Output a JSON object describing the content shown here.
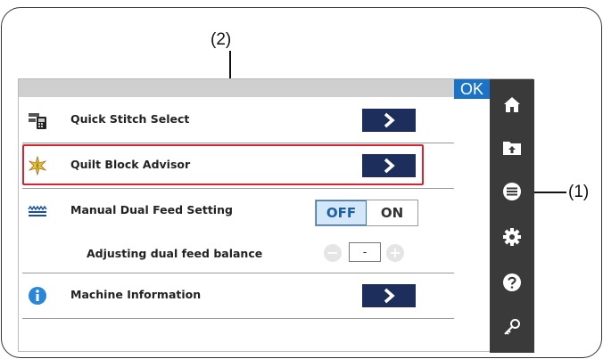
{
  "callouts": {
    "label_2": "(2)",
    "label_1": "(1)"
  },
  "header": {
    "ok_label": "OK"
  },
  "menu": {
    "items": [
      {
        "label": "Quick Stitch Select",
        "icon": "machine-panel-icon"
      },
      {
        "label": "Quilt Block Advisor",
        "icon": "quilt-star-icon"
      },
      {
        "label": "Manual Dual Feed Setting",
        "icon": "dual-feed-icon",
        "toggle_off": "OFF",
        "toggle_on": "ON",
        "selected": "OFF"
      },
      {
        "label": "Adjusting dual feed balance",
        "value": "-",
        "minus": "−",
        "plus": "+"
      },
      {
        "label": "Machine Information",
        "icon": "info-icon"
      }
    ]
  },
  "sidebar": {
    "items": [
      {
        "icon": "home-icon"
      },
      {
        "icon": "folder-upload-icon"
      },
      {
        "icon": "menu-icon",
        "active": true
      },
      {
        "icon": "gear-icon"
      },
      {
        "icon": "help-icon"
      },
      {
        "icon": "key-icon"
      }
    ]
  },
  "colors": {
    "accent_blue": "#1a73c6",
    "arrow_button": "#1d2d5c",
    "highlight": "#d9232e",
    "sidebar": "#3a3a3a",
    "header_bar": "#cfcfcf"
  }
}
